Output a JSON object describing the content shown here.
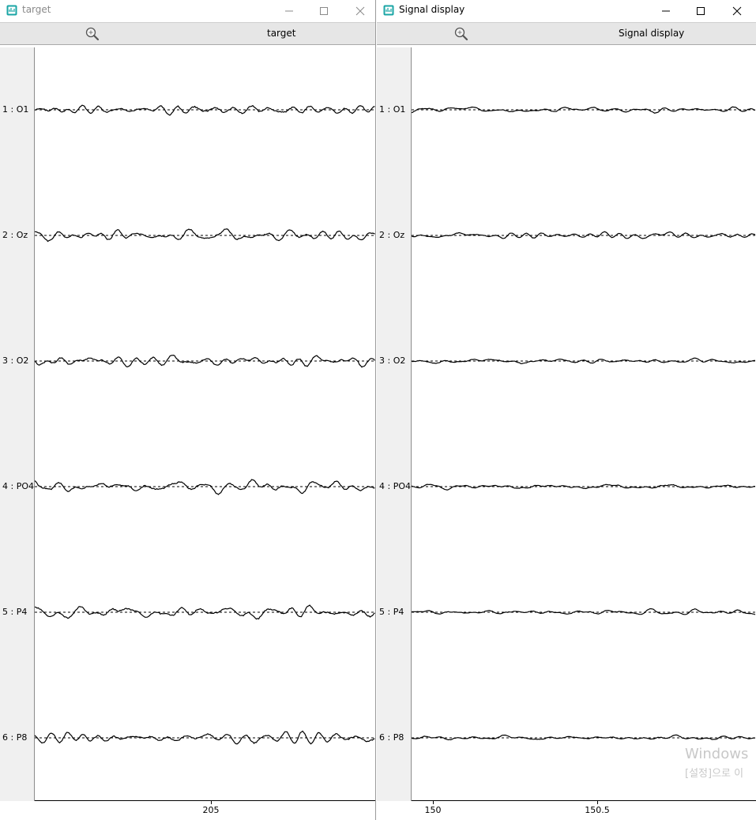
{
  "windows": [
    {
      "id": "left",
      "title": "target",
      "toolbar_label": "target",
      "title_inactive": true,
      "channels": [
        "1 : O1",
        "2 : Oz",
        "3 : O2",
        "4 : PO4",
        "5 : P4",
        "6 : P8"
      ],
      "x_ticks": [
        {
          "label": "205"
        }
      ],
      "amplitude": 1.0
    },
    {
      "id": "right",
      "title": "Signal display",
      "toolbar_label": "Signal display",
      "title_inactive": false,
      "channels": [
        "1 : O1",
        "2 : Oz",
        "3 : O2",
        "4 : PO4",
        "5 : P4",
        "6 : P8"
      ],
      "x_ticks": [
        {
          "label": "150"
        },
        {
          "label": "150.5"
        }
      ],
      "amplitude": 0.45
    }
  ],
  "icons": {
    "app": "signal-display-app-icon",
    "zoom": "zoom-magnifier-icon",
    "minimize": "minimize-icon",
    "maximize": "maximize-icon",
    "close": "close-icon"
  },
  "colors": {
    "app_icon": "#1aa5a5",
    "signal": "#000000",
    "baseline": "#000000",
    "gutter": "#f0f0f0",
    "toolbar": "#e6e6e6"
  },
  "watermark": {
    "line1": "Windows",
    "line2": "[설정]으로 이"
  }
}
